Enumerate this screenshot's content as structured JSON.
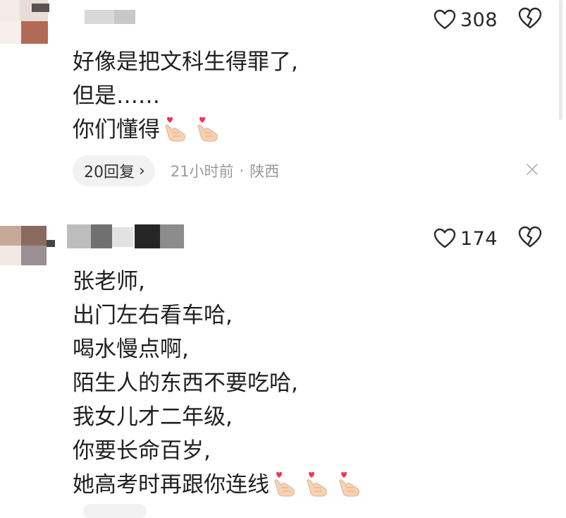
{
  "comments": [
    {
      "like_count": "308",
      "lines": [
        "好像是把文科生得罪了,",
        "但是……",
        "你们懂得"
      ],
      "emoji_line_index": 2,
      "emoji_count": 2,
      "emoji_icon": "finger-heart-icon",
      "reply_label": "20回复",
      "time": "21小时前",
      "separator": "·",
      "location": "陕西"
    },
    {
      "like_count": "174",
      "lines": [
        "张老师,",
        "出门左右看车哈,",
        "喝水慢点啊,",
        "陌生人的东西不要吃哈,",
        "我女儿才二年级,",
        "你要长命百岁,",
        "她高考时再跟你连线"
      ],
      "emoji_line_index": 6,
      "emoji_count": 3,
      "emoji_icon": "finger-heart-icon"
    }
  ],
  "colors": {
    "accent_heart": "#f0325a",
    "meta_gray": "#9a9a9a",
    "pill_bg": "#f2f2f2"
  },
  "icons": [
    "heart-outline-icon",
    "broken-heart-icon",
    "close-icon",
    "chevron-right-icon"
  ]
}
